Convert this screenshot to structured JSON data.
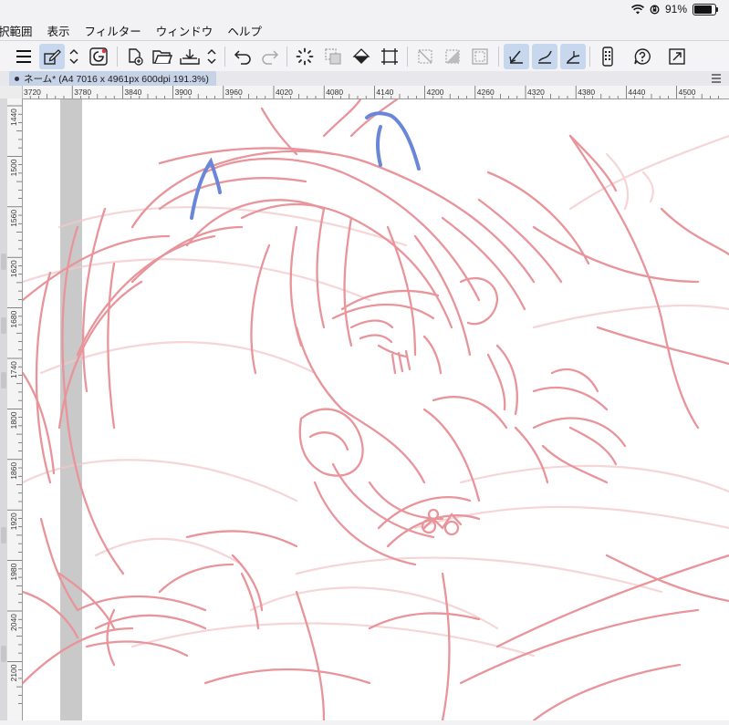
{
  "status_bar": {
    "battery_percent": "91%",
    "battery_level": 0.91
  },
  "menu": {
    "items": [
      {
        "id": "selection",
        "label": "択範囲"
      },
      {
        "id": "view",
        "label": "表示"
      },
      {
        "id": "filter",
        "label": "フィルター"
      },
      {
        "id": "window",
        "label": "ウィンドウ"
      },
      {
        "id": "help",
        "label": "ヘルプ"
      }
    ]
  },
  "toolbar": {
    "icons": [
      "menu-icon",
      "edit-mode-icon",
      "chevron-updown-icon",
      "clip-logo-icon",
      "new-file-icon",
      "open-folder-icon",
      "save-icon",
      "chevron-updown-icon",
      "undo-icon",
      "redo-icon",
      "loading-spinner-icon",
      "copy-layer-icon",
      "fill-bucket-icon",
      "transform-icon",
      "clear-selection-icon",
      "invert-selection-icon",
      "selection-border-icon",
      "line-correction-1-icon",
      "line-correction-2-icon",
      "line-correction-3-icon",
      "phone-icon",
      "help-icon",
      "fullscreen-icon"
    ],
    "active_color": "#c7d7ee"
  },
  "document": {
    "tab_label": "ネーム* (A4 7016 x 4961px 600dpi 191.3%)"
  },
  "rulers": {
    "top": [
      "3720",
      "3780",
      "3840",
      "3900",
      "3960",
      "4020",
      "4080",
      "4140",
      "4200",
      "4260",
      "4320",
      "4380",
      "4440",
      "4500"
    ],
    "left": [
      "1440",
      "1500",
      "1560",
      "1620",
      "1680",
      "1740",
      "1800",
      "1860",
      "1920",
      "1980",
      "2040",
      "2100"
    ]
  },
  "canvas": {
    "sketch_color": "#e8949a",
    "faint_sketch_color": "#f3c7c9",
    "accent_stroke_color": "#6a86d8",
    "guide_color": "#c9c9c9"
  }
}
